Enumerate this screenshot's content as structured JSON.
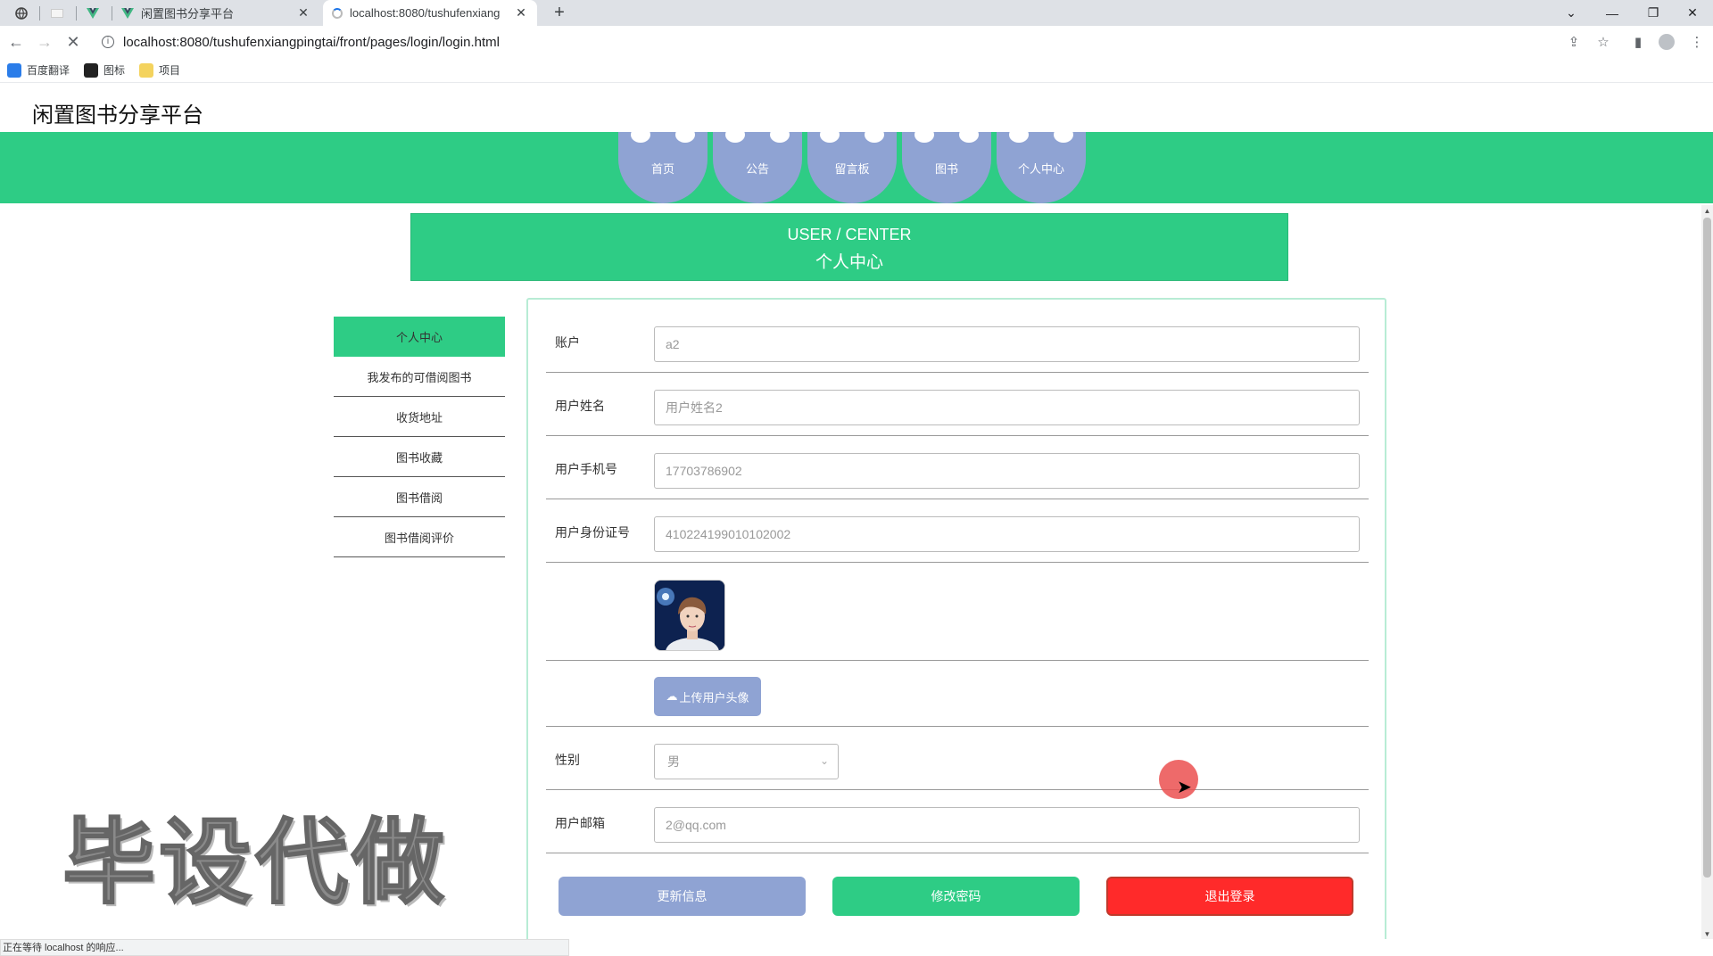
{
  "browser": {
    "tabs": [
      {
        "title": "闲置图书分享平台",
        "active": false
      },
      {
        "title": "localhost:8080/tushufenxiang",
        "active": true
      }
    ],
    "url": "localhost:8080/tushufenxiangpingtai/front/pages/login/login.html",
    "bookmarks": [
      "百度翻译",
      "图标",
      "项目"
    ],
    "status": "正在等待 localhost 的响应..."
  },
  "site": {
    "brand": "闲置图书分享平台",
    "nav": [
      "首页",
      "公告",
      "留言板",
      "图书",
      "个人中心"
    ]
  },
  "banner": {
    "en": "USER / CENTER",
    "zh": "个人中心"
  },
  "sidemenu": [
    "个人中心",
    "我发布的可借阅图书",
    "收货地址",
    "图书收藏",
    "图书借阅",
    "图书借阅评价"
  ],
  "form": {
    "account": {
      "label": "账户",
      "value": "a2"
    },
    "name": {
      "label": "用户姓名",
      "value": "用户姓名2"
    },
    "phone": {
      "label": "用户手机号",
      "value": "17703786902"
    },
    "idcard": {
      "label": "用户身份证号",
      "value": "410224199010102002"
    },
    "upload_label": "上传用户头像",
    "gender": {
      "label": "性别",
      "value": "男"
    },
    "email": {
      "label": "用户邮箱",
      "value": "2@qq.com"
    }
  },
  "buttons": {
    "update": "更新信息",
    "password": "修改密码",
    "logout": "退出登录"
  },
  "colors": {
    "green": "#2ecc85",
    "periwinkle": "#8fa3d3",
    "red": "#ff2a2a"
  },
  "watermark": "毕设代做"
}
